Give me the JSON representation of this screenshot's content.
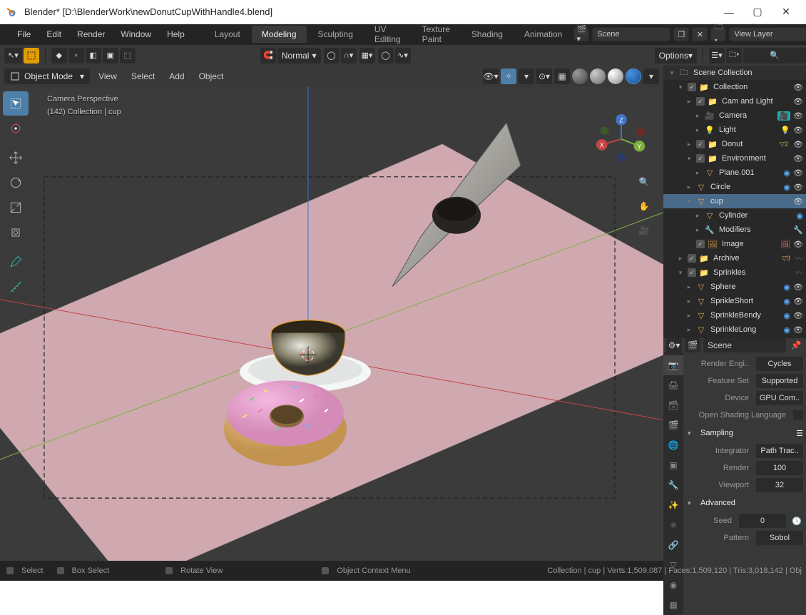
{
  "titlebar": {
    "title": "Blender* [D:\\BlenderWork\\newDonutCupWithHandle4.blend]"
  },
  "menubar": {
    "items": [
      "File",
      "Edit",
      "Render",
      "Window",
      "Help"
    ]
  },
  "workspace_tabs": {
    "items": [
      "Layout",
      "Modeling",
      "Sculpting",
      "UV Editing",
      "Texture Paint",
      "Shading",
      "Animation"
    ],
    "active": "Modeling"
  },
  "header": {
    "scene_label": "Scene",
    "viewlayer_label": "View Layer"
  },
  "row2": {
    "snap": "Normal",
    "options": "Options"
  },
  "viewport_header": {
    "mode": "Object Mode",
    "menus": [
      "View",
      "Select",
      "Add",
      "Object"
    ]
  },
  "viewport_overlay": {
    "line1": "Camera Perspective",
    "line2": "(142) Collection | cup"
  },
  "outliner": {
    "root": "Scene Collection",
    "nodes": [
      {
        "indent": 1,
        "tw": "▾",
        "cb": true,
        "icon": "collection",
        "name": "Collection",
        "tail": [
          "eye"
        ]
      },
      {
        "indent": 2,
        "tw": "▸",
        "cb": true,
        "icon": "collection",
        "name": "Cam and Light",
        "tail": [
          "eye"
        ]
      },
      {
        "indent": 3,
        "tw": "▸",
        "cb": false,
        "icon": "camera",
        "name": "Camera",
        "tail": [
          "cam",
          "eye"
        ]
      },
      {
        "indent": 3,
        "tw": "▸",
        "cb": false,
        "icon": "light",
        "name": "Light",
        "tail": [
          "light",
          "eye"
        ]
      },
      {
        "indent": 2,
        "tw": "▸",
        "cb": true,
        "icon": "collection",
        "name": "Donut",
        "tail": [
          "badge2",
          "eye"
        ]
      },
      {
        "indent": 2,
        "tw": "▾",
        "cb": true,
        "icon": "collection",
        "name": "Environment",
        "tail": [
          "eye"
        ]
      },
      {
        "indent": 3,
        "tw": "▸",
        "cb": false,
        "icon": "mesh",
        "name": "Plane.001",
        "tail": [
          "mat",
          "eye"
        ]
      },
      {
        "indent": 2,
        "tw": "▸",
        "cb": false,
        "icon": "mesh",
        "name": "Circle",
        "tail": [
          "mat",
          "eye"
        ]
      },
      {
        "indent": 2,
        "tw": "▾",
        "cb": false,
        "icon": "mesh",
        "name": "cup",
        "tail": [
          "eye"
        ],
        "selected": true
      },
      {
        "indent": 3,
        "tw": "▸",
        "cb": false,
        "icon": "mesh",
        "name": "Cylinder",
        "tail": [
          "mat"
        ]
      },
      {
        "indent": 3,
        "tw": "▸",
        "cb": false,
        "icon": "modifier",
        "name": "Modifiers",
        "tail": [
          "wrench"
        ]
      },
      {
        "indent": 2,
        "tw": "",
        "cb": true,
        "icon": "image",
        "name": "Image",
        "tail": [
          "img",
          "eye"
        ]
      },
      {
        "indent": 1,
        "tw": "▸",
        "cb": true,
        "icon": "collection",
        "name": "Archive",
        "tail": [
          "badge3",
          "hidden"
        ]
      },
      {
        "indent": 1,
        "tw": "▾",
        "cb": true,
        "icon": "collection",
        "name": "Sprinkles",
        "tail": [
          "hidden"
        ]
      },
      {
        "indent": 2,
        "tw": "▸",
        "cb": false,
        "icon": "mesh",
        "name": "Sphere",
        "tail": [
          "mat",
          "eye"
        ]
      },
      {
        "indent": 2,
        "tw": "▸",
        "cb": false,
        "icon": "mesh",
        "name": "SprikleShort",
        "tail": [
          "mat",
          "eye"
        ]
      },
      {
        "indent": 2,
        "tw": "▸",
        "cb": false,
        "icon": "mesh",
        "name": "SprinkleBendy",
        "tail": [
          "mat",
          "eye"
        ]
      },
      {
        "indent": 2,
        "tw": "▸",
        "cb": false,
        "icon": "mesh",
        "name": "SprinkleLong",
        "tail": [
          "mat",
          "eye"
        ]
      }
    ]
  },
  "scene_hdr": {
    "label": "Scene"
  },
  "props": {
    "render_engine": {
      "label": "Render Engi..",
      "value": "Cycles"
    },
    "feature_set": {
      "label": "Feature Set",
      "value": "Supported"
    },
    "device": {
      "label": "Device",
      "value": "GPU Com.."
    },
    "osl": {
      "label": "Open Shading Language"
    },
    "sampling_h": "Sampling",
    "integrator": {
      "label": "Integrator",
      "value": "Path Trac.."
    },
    "render": {
      "label": "Render",
      "value": "100"
    },
    "viewport": {
      "label": "Viewport",
      "value": "32"
    },
    "advanced_h": "Advanced",
    "seed": {
      "label": "Seed",
      "value": "0"
    },
    "pattern": {
      "label": "Pattern",
      "value": "Sobol"
    }
  },
  "statusbar": {
    "select": "Select",
    "boxselect": "Box Select",
    "rotate": "Rotate View",
    "context": "Object Context Menu",
    "right": "Collection | cup | Verts:1,509,087 | Faces:1,509,120 | Tris:3,018,142 | Obj"
  }
}
